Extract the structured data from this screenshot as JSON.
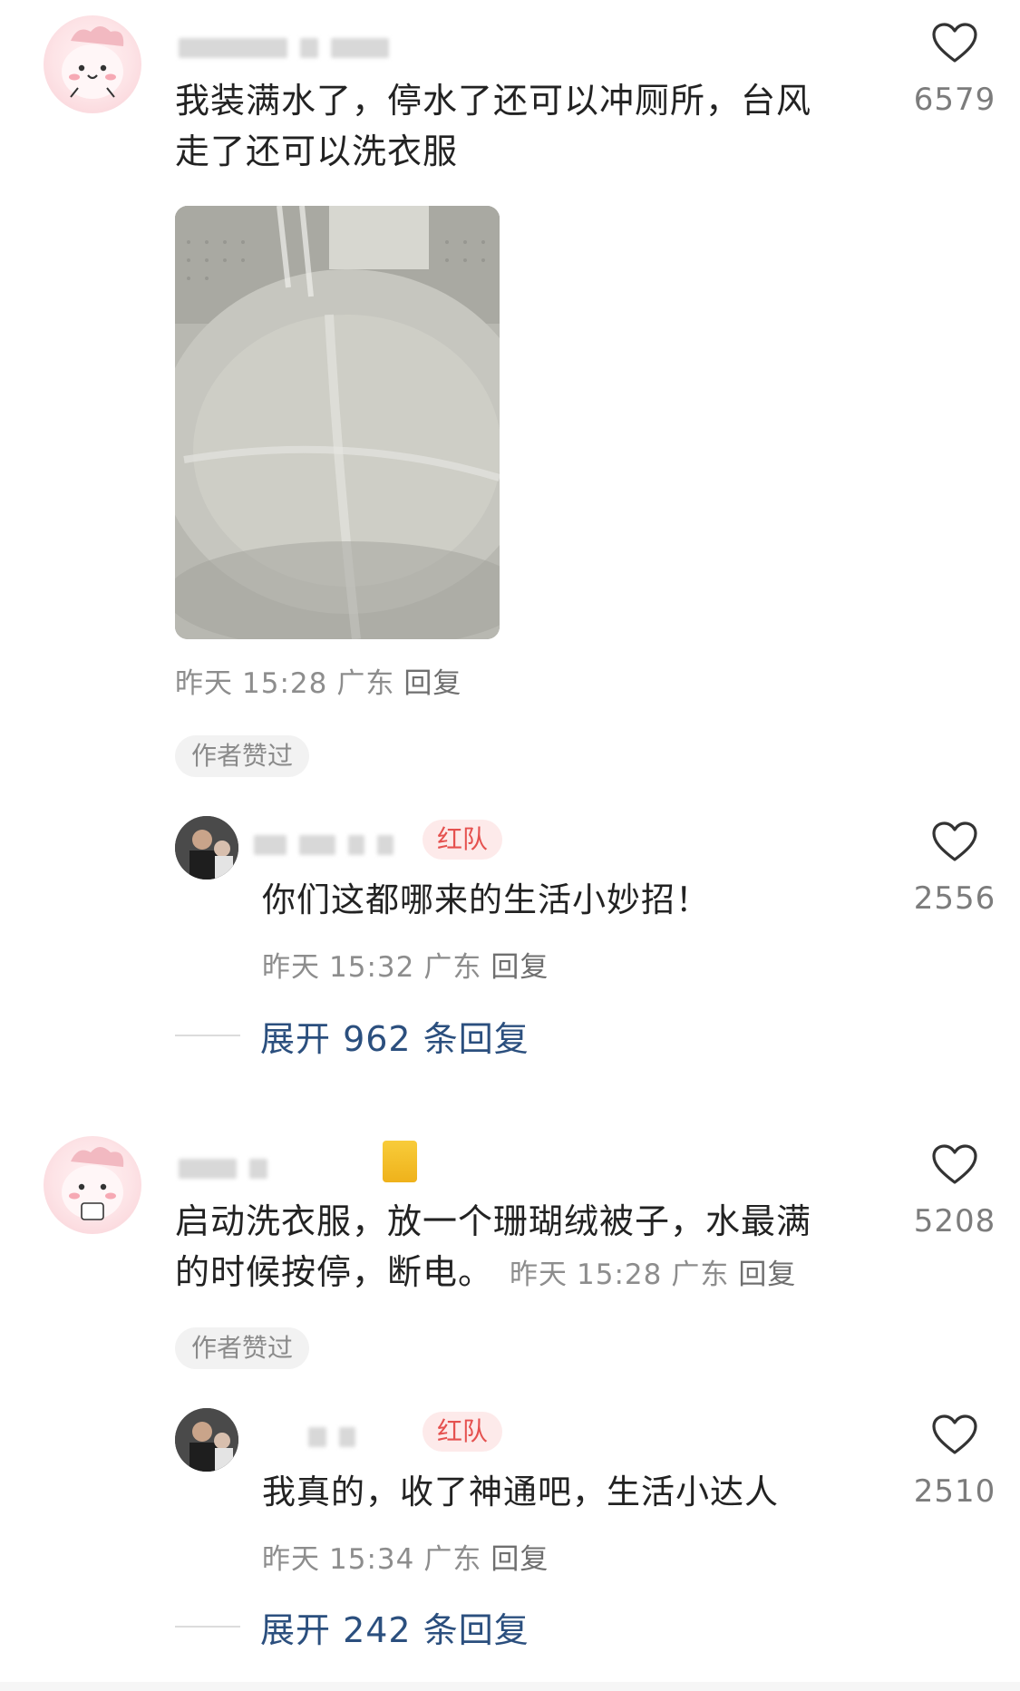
{
  "comments": [
    {
      "text_line1": "我装满水了，停水了还可以冲厕所，台风",
      "text_line2": "走了还可以洗衣服",
      "meta": {
        "date": "昨天",
        "time": "15:28",
        "location": "广东",
        "reply": "回复"
      },
      "likes": "6579",
      "tag": "作者赞过",
      "reply": {
        "badge": "红队",
        "text": "你们这都哪来的生活小妙招！",
        "meta": {
          "date": "昨天",
          "time": "15:32",
          "location": "广东",
          "reply": "回复"
        },
        "likes": "2556"
      },
      "expand": "展开 962 条回复"
    },
    {
      "text_line1": "启动洗衣服，放一个珊瑚绒被子，水最满",
      "text_line2": "的时候按停，断电。",
      "meta": {
        "date": "昨天",
        "time": "15:28",
        "location": "广东",
        "reply": "回复"
      },
      "likes": "5208",
      "tag": "作者赞过",
      "reply": {
        "badge": "红队",
        "text": "我真的，收了神通吧，生活小达人",
        "meta": {
          "date": "昨天",
          "time": "15:34",
          "location": "广东",
          "reply": "回复"
        },
        "likes": "2510"
      },
      "expand": "展开 242 条回复"
    }
  ],
  "colors": {
    "link": "#2b4f7e",
    "meta": "#8d8d8d",
    "badge_red": "#e5514f",
    "badge_red_bg": "#fdeaea"
  },
  "icons": {
    "like": "heart-outline-icon"
  }
}
